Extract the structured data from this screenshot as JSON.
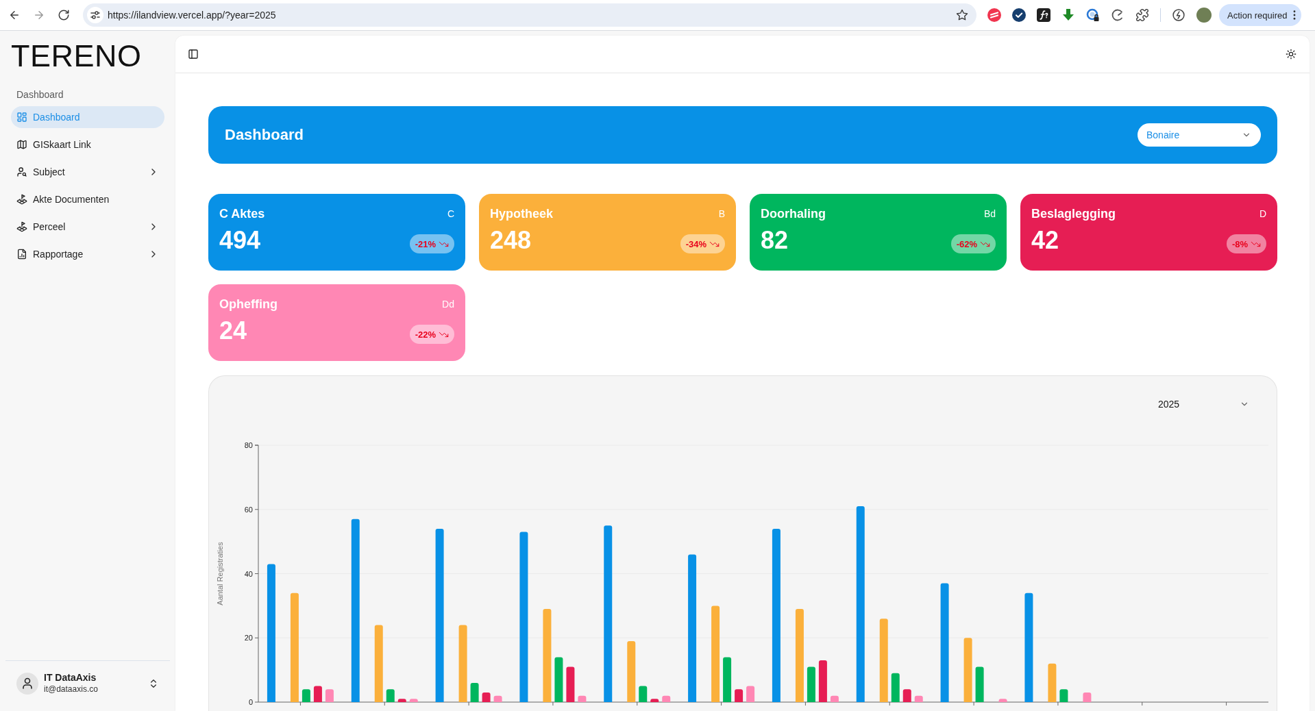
{
  "browser": {
    "url": "https://ilandview.vercel.app/?year=2025",
    "action_button": "Action required"
  },
  "sidebar": {
    "logo": "TERENO",
    "group_label": "Dashboard",
    "items": [
      {
        "label": "Dashboard",
        "selected": true,
        "expandable": false
      },
      {
        "label": "GISkaart Link",
        "selected": false,
        "expandable": false
      },
      {
        "label": "Subject",
        "selected": false,
        "expandable": true
      },
      {
        "label": "Akte Documenten",
        "selected": false,
        "expandable": false
      },
      {
        "label": "Perceel",
        "selected": false,
        "expandable": true
      },
      {
        "label": "Rapportage",
        "selected": false,
        "expandable": true
      }
    ],
    "user": {
      "name": "IT DataAxis",
      "email": "it@dataaxis.co"
    }
  },
  "header": {
    "title": "Dashboard",
    "region_select": {
      "value": "Bonaire"
    }
  },
  "stat_cards": [
    {
      "title": "C Aktes",
      "code": "C",
      "value": "494",
      "change": "-21%",
      "falling": true,
      "color": "#0891e6"
    },
    {
      "title": "Hypotheek",
      "code": "B",
      "value": "248",
      "change": "-34%",
      "falling": true,
      "color": "#fbb03b"
    },
    {
      "title": "Doorhaling",
      "code": "Bd",
      "value": "82",
      "change": "-62%",
      "falling": true,
      "color": "#00b65e"
    },
    {
      "title": "Beslaglegging",
      "code": "D",
      "value": "42",
      "change": "-8%",
      "falling": true,
      "color": "#e61e54"
    },
    {
      "title": "Opheffing",
      "code": "Dd",
      "value": "24",
      "change": "-22%",
      "falling": true,
      "color": "#ff87b4"
    }
  ],
  "chart_panel": {
    "year_select": {
      "value": "2025"
    },
    "chart_data": [
      {
        "type": "bar",
        "ylabel": "Aantal Registraties",
        "categories": [
          null,
          null,
          null,
          null,
          null,
          null,
          null,
          null,
          null,
          null,
          null,
          null
        ],
        "ylim": [
          0,
          80
        ],
        "yticks": [
          0,
          20,
          40,
          60,
          80
        ],
        "grid": true,
        "series": [
          {
            "color": "#0891e6",
            "values": [
              43,
              57,
              54,
              53,
              55,
              46,
              54,
              61,
              37,
              34,
              null,
              null
            ]
          },
          {
            "color": "#fbb03b",
            "values": [
              34,
              24,
              24,
              29,
              19,
              30,
              29,
              26,
              20,
              12,
              null,
              null
            ]
          },
          {
            "color": "#00b65e",
            "values": [
              4,
              4,
              6,
              14,
              5,
              14,
              11,
              9,
              11,
              4,
              null,
              null
            ]
          },
          {
            "color": "#e61e54",
            "values": [
              5,
              1,
              3,
              11,
              1,
              4,
              13,
              4,
              0,
              0,
              null,
              null
            ]
          },
          {
            "color": "#ff87b4",
            "values": [
              4,
              1,
              2,
              2,
              2,
              5,
              2,
              2,
              1,
              3,
              null,
              null
            ]
          }
        ]
      }
    ]
  }
}
